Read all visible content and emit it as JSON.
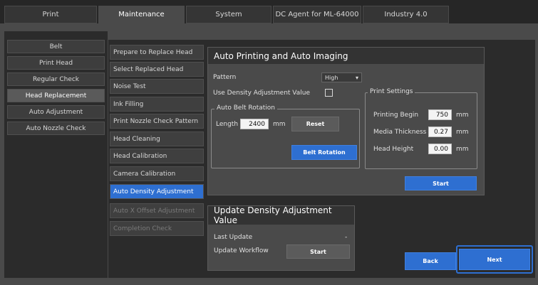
{
  "top_tabs": [
    "Print",
    "Maintenance",
    "System",
    "DC Agent for ML-64000",
    "Industry 4.0"
  ],
  "left_menu": [
    "Belt",
    "Print Head",
    "Regular Check",
    "Head Replacement",
    "Auto Adjustment",
    "Auto Nozzle Check"
  ],
  "sub_menu": [
    "Prepare to Replace Head",
    "Select Replaced Head",
    "Noise Test",
    "Ink Filling",
    "Print Nozzle Check Pattern",
    "Head Cleaning",
    "Head Calibration",
    "Camera Calibration",
    "Auto Density Adjustment",
    "Auto X Offset Adjustment",
    "Completion Check"
  ],
  "auto_print": {
    "title": "Auto Printing and Auto Imaging",
    "pattern_label": "Pattern",
    "pattern_value": "High",
    "use_density_label": "Use Density Adjustment Value",
    "belt_group": "Auto Belt Rotation",
    "length_label": "Length",
    "length_value": "2400",
    "length_unit": "mm",
    "reset_label": "Reset",
    "belt_rotation_label": "Belt Rotation",
    "print_settings_group": "Print Settings",
    "printing_begin_label": "Printing Begin",
    "printing_begin_value": "750",
    "media_thickness_label": "Media Thickness",
    "media_thickness_value": "0.27",
    "head_height_label": "Head Height",
    "head_height_value": "0.00",
    "unit_mm": "mm",
    "start_label": "Start"
  },
  "update_density": {
    "title": "Update Density Adjustment Value",
    "last_update_label": "Last Update",
    "last_update_value": "-",
    "workflow_label": "Update Workflow",
    "start_label": "Start"
  },
  "nav": {
    "back_label": "Back",
    "next_label": "Next"
  },
  "colors": {
    "accent": "#2e6fd1",
    "panel": "#4a4a4a",
    "background": "#1b1b1b"
  }
}
